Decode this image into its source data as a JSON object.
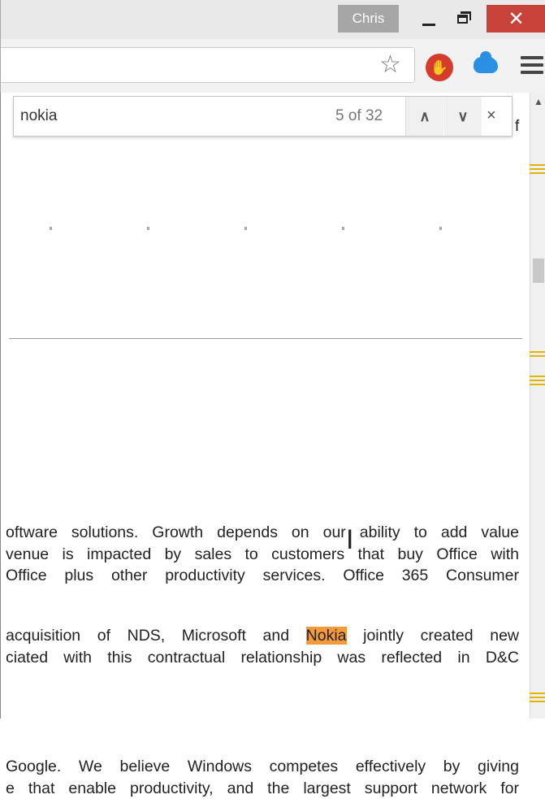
{
  "window": {
    "user": "Chris",
    "minimize_icon": "minimize-icon",
    "maximize_icon": "restore-icon",
    "close_glyph": "✕"
  },
  "toolbar": {
    "omnibox_value": "",
    "star_glyph": "☆",
    "stop_glyph": "✋"
  },
  "find": {
    "query": "nokia",
    "count": "5 of 32",
    "prev_glyph": "∧",
    "next_glyph": "∨",
    "close_glyph": "×",
    "stray_text": "f"
  },
  "document": {
    "para1": [
      "oftware solutions. Growth depends on our ability to add value",
      "venue is impacted by sales to customers that buy Office with",
      " Office plus other productivity services. Office 365 Consumer"
    ],
    "para2_line1_before": " acquisition of NDS, Microsoft and ",
    "para2_highlight": "Nokia",
    "para2_line1_after": " jointly created new",
    "para2_line2": "ciated with this contractual relationship was reflected in D&C",
    "para3": [
      "Google. We believe Windows competes effectively by giving",
      "e that enable productivity, and the largest support network for"
    ]
  },
  "colors": {
    "highlight": "#f39a3b",
    "scroll_marker": "#e1b400",
    "close_button": "#c7433a"
  }
}
